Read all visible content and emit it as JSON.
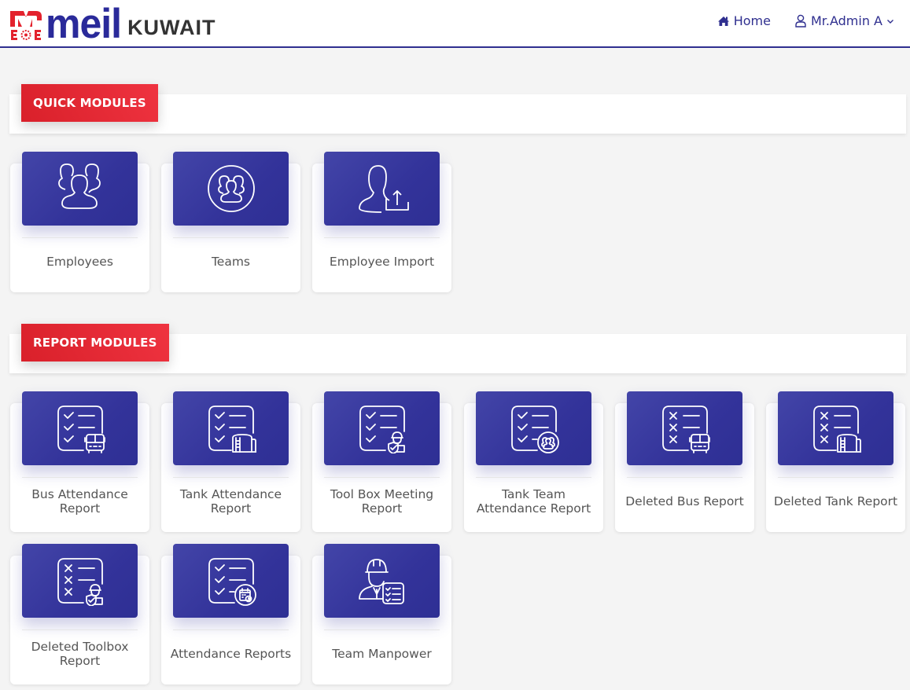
{
  "header": {
    "logo_text": "meil",
    "logo_subtext": "KUWAIT",
    "nav": {
      "home_label": "Home",
      "user_label": "Mr.Admin A"
    }
  },
  "colors": {
    "brand_blue": "#2f2f8f",
    "accent_red": "#e3222d",
    "tile_blue": "#3a3ca3"
  },
  "quick_modules": {
    "title": "QUICK MODULES",
    "items": [
      {
        "label": "Employees",
        "icon": "users-group-icon"
      },
      {
        "label": "Teams",
        "icon": "team-circle-icon"
      },
      {
        "label": "Employee Import",
        "icon": "user-upload-icon"
      }
    ]
  },
  "report_modules": {
    "title": "REPORT MODULES",
    "items": [
      {
        "label": "Bus Attendance Report",
        "icon": "checklist-bus-icon"
      },
      {
        "label": "Tank Attendance Report",
        "icon": "checklist-tank-icon"
      },
      {
        "label": "Tool Box Meeting Report",
        "icon": "checklist-worker-icon"
      },
      {
        "label": "Tank Team Attendance Report",
        "icon": "checklist-team-icon"
      },
      {
        "label": "Deleted Bus Report",
        "icon": "crosslist-bus-icon"
      },
      {
        "label": "Deleted Tank Report",
        "icon": "crosslist-tank-icon"
      },
      {
        "label": "Deleted Toolbox Report",
        "icon": "crosslist-worker-icon"
      },
      {
        "label": "Attendance Reports",
        "icon": "checklist-calendar-icon"
      },
      {
        "label": "Team Manpower",
        "icon": "engineer-checklist-icon"
      }
    ]
  }
}
